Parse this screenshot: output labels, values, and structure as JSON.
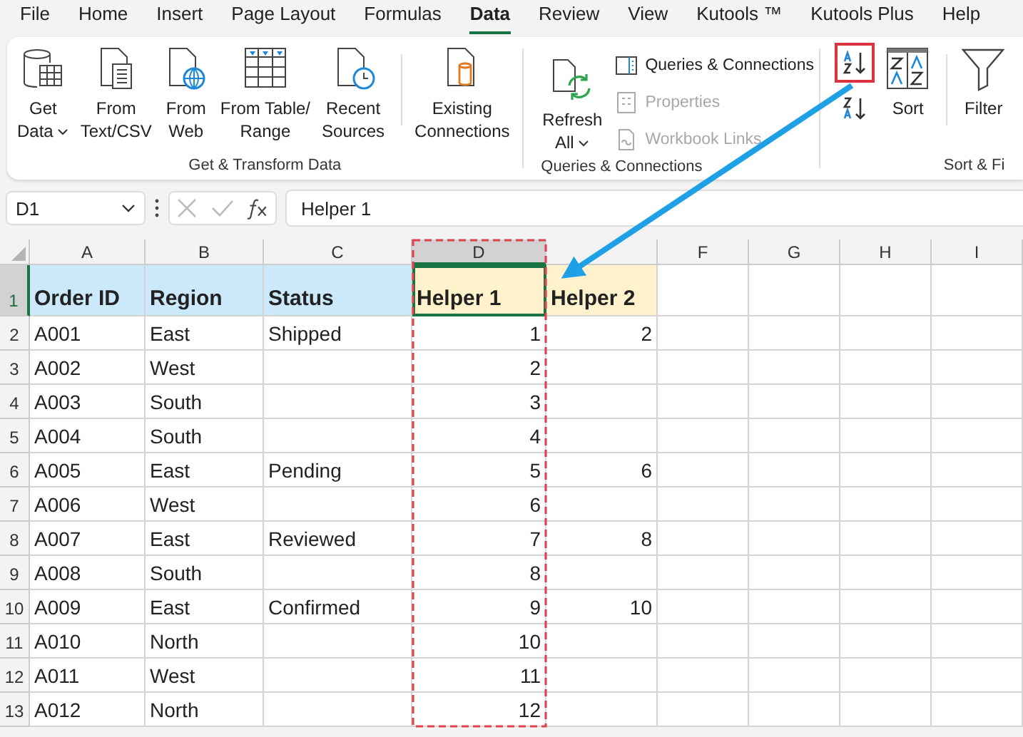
{
  "menu_tabs": [
    {
      "label": "File",
      "selected": false
    },
    {
      "label": "Home",
      "selected": false
    },
    {
      "label": "Insert",
      "selected": false
    },
    {
      "label": "Page Layout",
      "selected": false
    },
    {
      "label": "Formulas",
      "selected": false
    },
    {
      "label": "Data",
      "selected": true
    },
    {
      "label": "Review",
      "selected": false
    },
    {
      "label": "View",
      "selected": false
    },
    {
      "label": "Kutools ™",
      "selected": false
    },
    {
      "label": "Kutools Plus",
      "selected": false
    },
    {
      "label": "Help",
      "selected": false
    }
  ],
  "ribbon": {
    "get_transform": {
      "label": "Get & Transform Data",
      "buttons": [
        {
          "lines": [
            "Get",
            "Data"
          ],
          "dropdown": true
        },
        {
          "lines": [
            "From",
            "Text/CSV"
          ],
          "dropdown": false
        },
        {
          "lines": [
            "From",
            "Web"
          ],
          "dropdown": false
        },
        {
          "lines": [
            "From Table/",
            "Range"
          ],
          "dropdown": false
        },
        {
          "lines": [
            "Recent",
            "Sources"
          ],
          "dropdown": false
        },
        {
          "lines": [
            "Existing",
            "Connections"
          ],
          "dropdown": false
        }
      ]
    },
    "queries": {
      "label": "Queries & Connections",
      "refresh": {
        "lines": [
          "Refresh",
          "All"
        ],
        "dropdown": true
      },
      "items": [
        {
          "label": "Queries & Connections",
          "disabled": false
        },
        {
          "label": "Properties",
          "disabled": true
        },
        {
          "label": "Workbook Links",
          "disabled": true
        }
      ]
    },
    "sort_filter": {
      "label": "Sort & Fi",
      "sort_az_highlighted": true,
      "sort": "Sort",
      "filter": "Filter"
    }
  },
  "formula_bar": {
    "name_box": "D1",
    "formula": "Helper 1"
  },
  "sheet": {
    "columns": [
      {
        "label": "A",
        "selected": false
      },
      {
        "label": "B",
        "selected": false
      },
      {
        "label": "C",
        "selected": false
      },
      {
        "label": "D",
        "selected": true
      },
      {
        "selected": false
      },
      {
        "label": "F",
        "selected": false
      },
      {
        "label": "G",
        "selected": false
      },
      {
        "label": "H",
        "selected": false
      },
      {
        "label": "I",
        "selected": false
      }
    ],
    "header_row": {
      "number": "1",
      "selected": true,
      "cells": [
        {
          "text": "Order ID",
          "color": "#cce8fb"
        },
        {
          "text": "Region",
          "color": "#cce8fb"
        },
        {
          "text": "Status",
          "color": "#cce8fb"
        },
        {
          "text": "Helper 1",
          "color": "#fff2cc"
        },
        {
          "text": "Helper 2",
          "color": "#fff2cc"
        }
      ]
    },
    "rows": [
      {
        "number": "2",
        "cells": [
          "A001",
          "East",
          "Shipped",
          "1",
          "2"
        ]
      },
      {
        "number": "3",
        "cells": [
          "A002",
          "West",
          "",
          "2",
          ""
        ]
      },
      {
        "number": "4",
        "cells": [
          "A003",
          "South",
          "",
          "3",
          ""
        ]
      },
      {
        "number": "5",
        "cells": [
          "A004",
          "South",
          "",
          "4",
          ""
        ]
      },
      {
        "number": "6",
        "cells": [
          "A005",
          "East",
          "Pending",
          "5",
          "6"
        ]
      },
      {
        "number": "7",
        "cells": [
          "A006",
          "West",
          "",
          "6",
          ""
        ]
      },
      {
        "number": "8",
        "cells": [
          "A007",
          "East",
          "Reviewed",
          "7",
          "8"
        ]
      },
      {
        "number": "9",
        "cells": [
          "A008",
          "South",
          "",
          "8",
          ""
        ]
      },
      {
        "number": "10",
        "cells": [
          "A009",
          "East",
          "Confirmed",
          "9",
          "10"
        ]
      },
      {
        "number": "11",
        "cells": [
          "A010",
          "North",
          "",
          "10",
          ""
        ]
      },
      {
        "number": "12",
        "cells": [
          "A011",
          "West",
          "",
          "11",
          ""
        ]
      },
      {
        "number": "13",
        "cells": [
          "A012",
          "North",
          "",
          "12",
          ""
        ]
      }
    ]
  }
}
